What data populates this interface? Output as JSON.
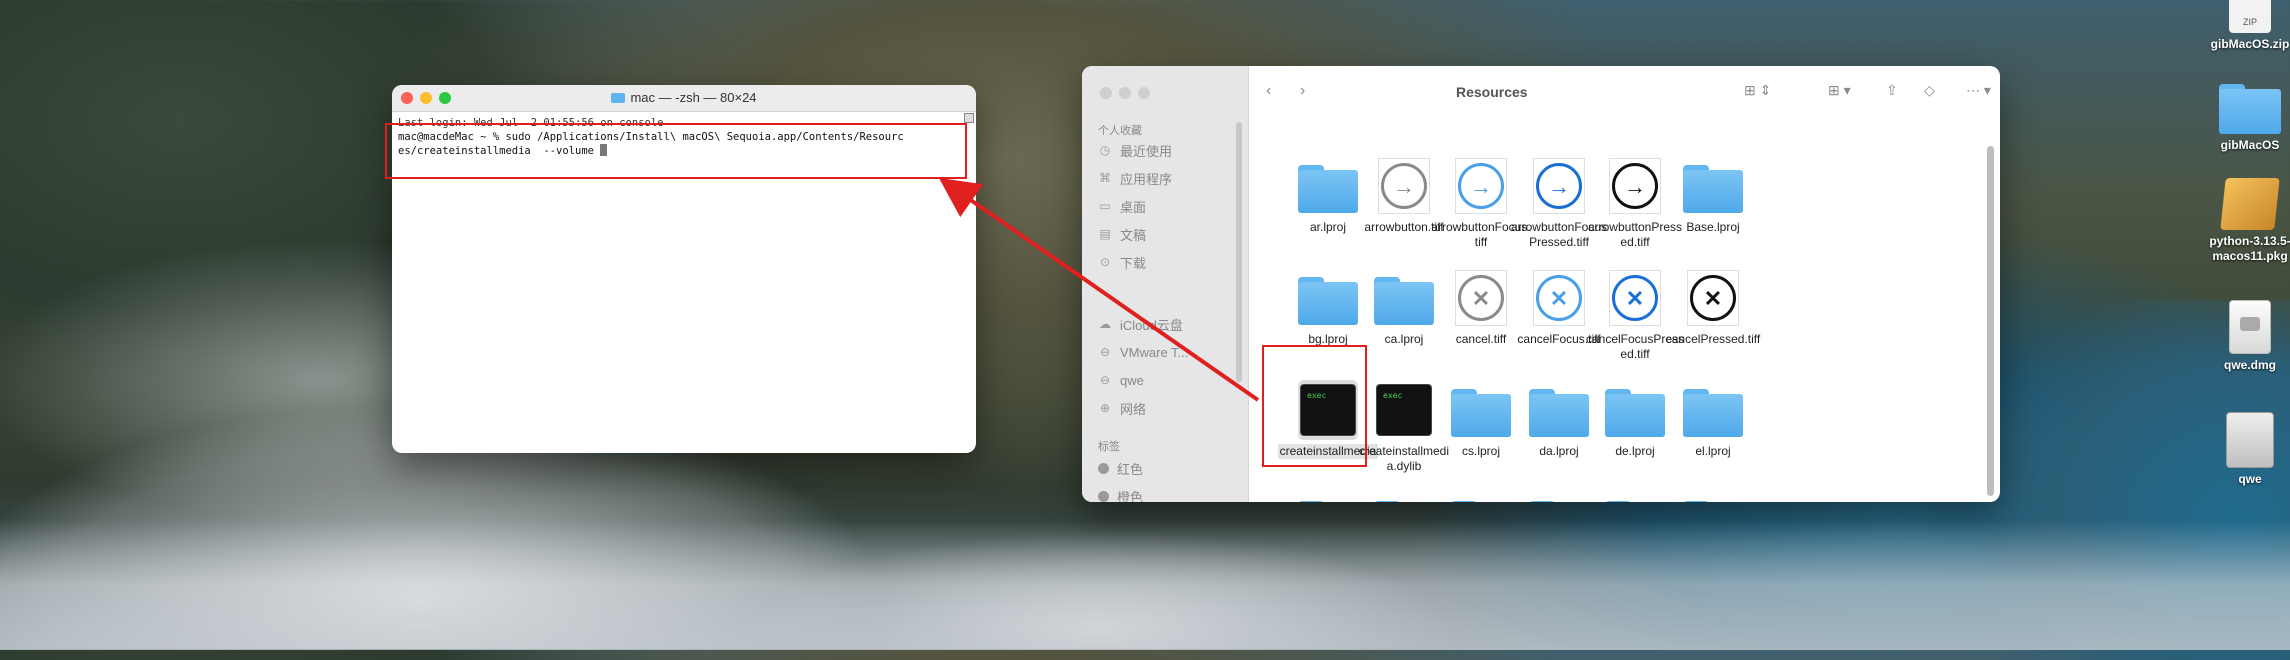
{
  "terminal": {
    "title": "mac — -zsh — 80×24",
    "lines": [
      "Last login: Wed Jul  2 01:55:56 on console",
      "mac@macdeMac ~ % sudo /Applications/Install\\ macOS\\ Sequoia.app/Contents/Resourc",
      "es/createinstallmedia  --volume "
    ]
  },
  "finder": {
    "title": "Resources",
    "sidebar": {
      "favorites_header": "个人收藏",
      "favorites": [
        {
          "label": "最近使用",
          "icon": "clock-icon"
        },
        {
          "label": "应用程序",
          "icon": "apps-icon"
        },
        {
          "label": "桌面",
          "icon": "desktop-icon"
        },
        {
          "label": "文稿",
          "icon": "document-icon"
        },
        {
          "label": "下载",
          "icon": "download-icon"
        }
      ],
      "locations": [
        {
          "label": "iCloud云盘",
          "icon": "cloud-icon"
        },
        {
          "label": "VMware T...",
          "icon": "disk-icon"
        },
        {
          "label": "qwe",
          "icon": "disk-icon"
        },
        {
          "label": "网络",
          "icon": "globe-icon"
        }
      ],
      "tags_header": "标签",
      "tags": [
        {
          "label": "红色",
          "color": "#9a9a9a"
        },
        {
          "label": "橙色",
          "color": "#9a9a9a"
        }
      ]
    },
    "items": [
      {
        "name": "ar.lproj",
        "type": "folder"
      },
      {
        "name": "arrowbutton.tiff",
        "type": "tiff",
        "glyph": "→",
        "color": "#8a8a8a"
      },
      {
        "name": "arrowbuttonFocus.tiff",
        "type": "tiff",
        "glyph": "→",
        "color": "#4a9fe8"
      },
      {
        "name": "arrowbuttonFocusPressed.tiff",
        "type": "tiff",
        "glyph": "→",
        "color": "#1a6fd6"
      },
      {
        "name": "arrowbuttonPressed.tiff",
        "type": "tiff",
        "glyph": "→",
        "color": "#111111"
      },
      {
        "name": "Base.lproj",
        "type": "folder"
      },
      {
        "name": "bg.lproj",
        "type": "folder"
      },
      {
        "name": "ca.lproj",
        "type": "folder"
      },
      {
        "name": "cancel.tiff",
        "type": "tiff",
        "glyph": "✕",
        "color": "#8a8a8a"
      },
      {
        "name": "cancelFocus.tiff",
        "type": "tiff",
        "glyph": "✕",
        "color": "#4a9fe8"
      },
      {
        "name": "cancelFocusPressed.tiff",
        "type": "tiff",
        "glyph": "✕",
        "color": "#1a6fd6"
      },
      {
        "name": "cancelPressed.tiff",
        "type": "tiff",
        "glyph": "✕",
        "color": "#111111"
      },
      {
        "name": "createinstallmedia",
        "type": "exec",
        "selected": true
      },
      {
        "name": "createinstallmedia.dylib",
        "type": "exec"
      },
      {
        "name": "cs.lproj",
        "type": "folder"
      },
      {
        "name": "da.lproj",
        "type": "folder"
      },
      {
        "name": "de.lproj",
        "type": "folder"
      },
      {
        "name": "el.lproj",
        "type": "folder"
      }
    ],
    "exec_label": "exec"
  },
  "desktop": [
    {
      "name": "gibMacOS.zip",
      "type": "zip",
      "badge": "ZIP"
    },
    {
      "name": "gibMacOS",
      "type": "folder"
    },
    {
      "name": "python-3.13.5-macos11.pkg",
      "type": "pkg"
    },
    {
      "name": "qwe.dmg",
      "type": "dmg"
    },
    {
      "name": "qwe",
      "type": "drive"
    }
  ],
  "annotation_color": "#e0201f"
}
